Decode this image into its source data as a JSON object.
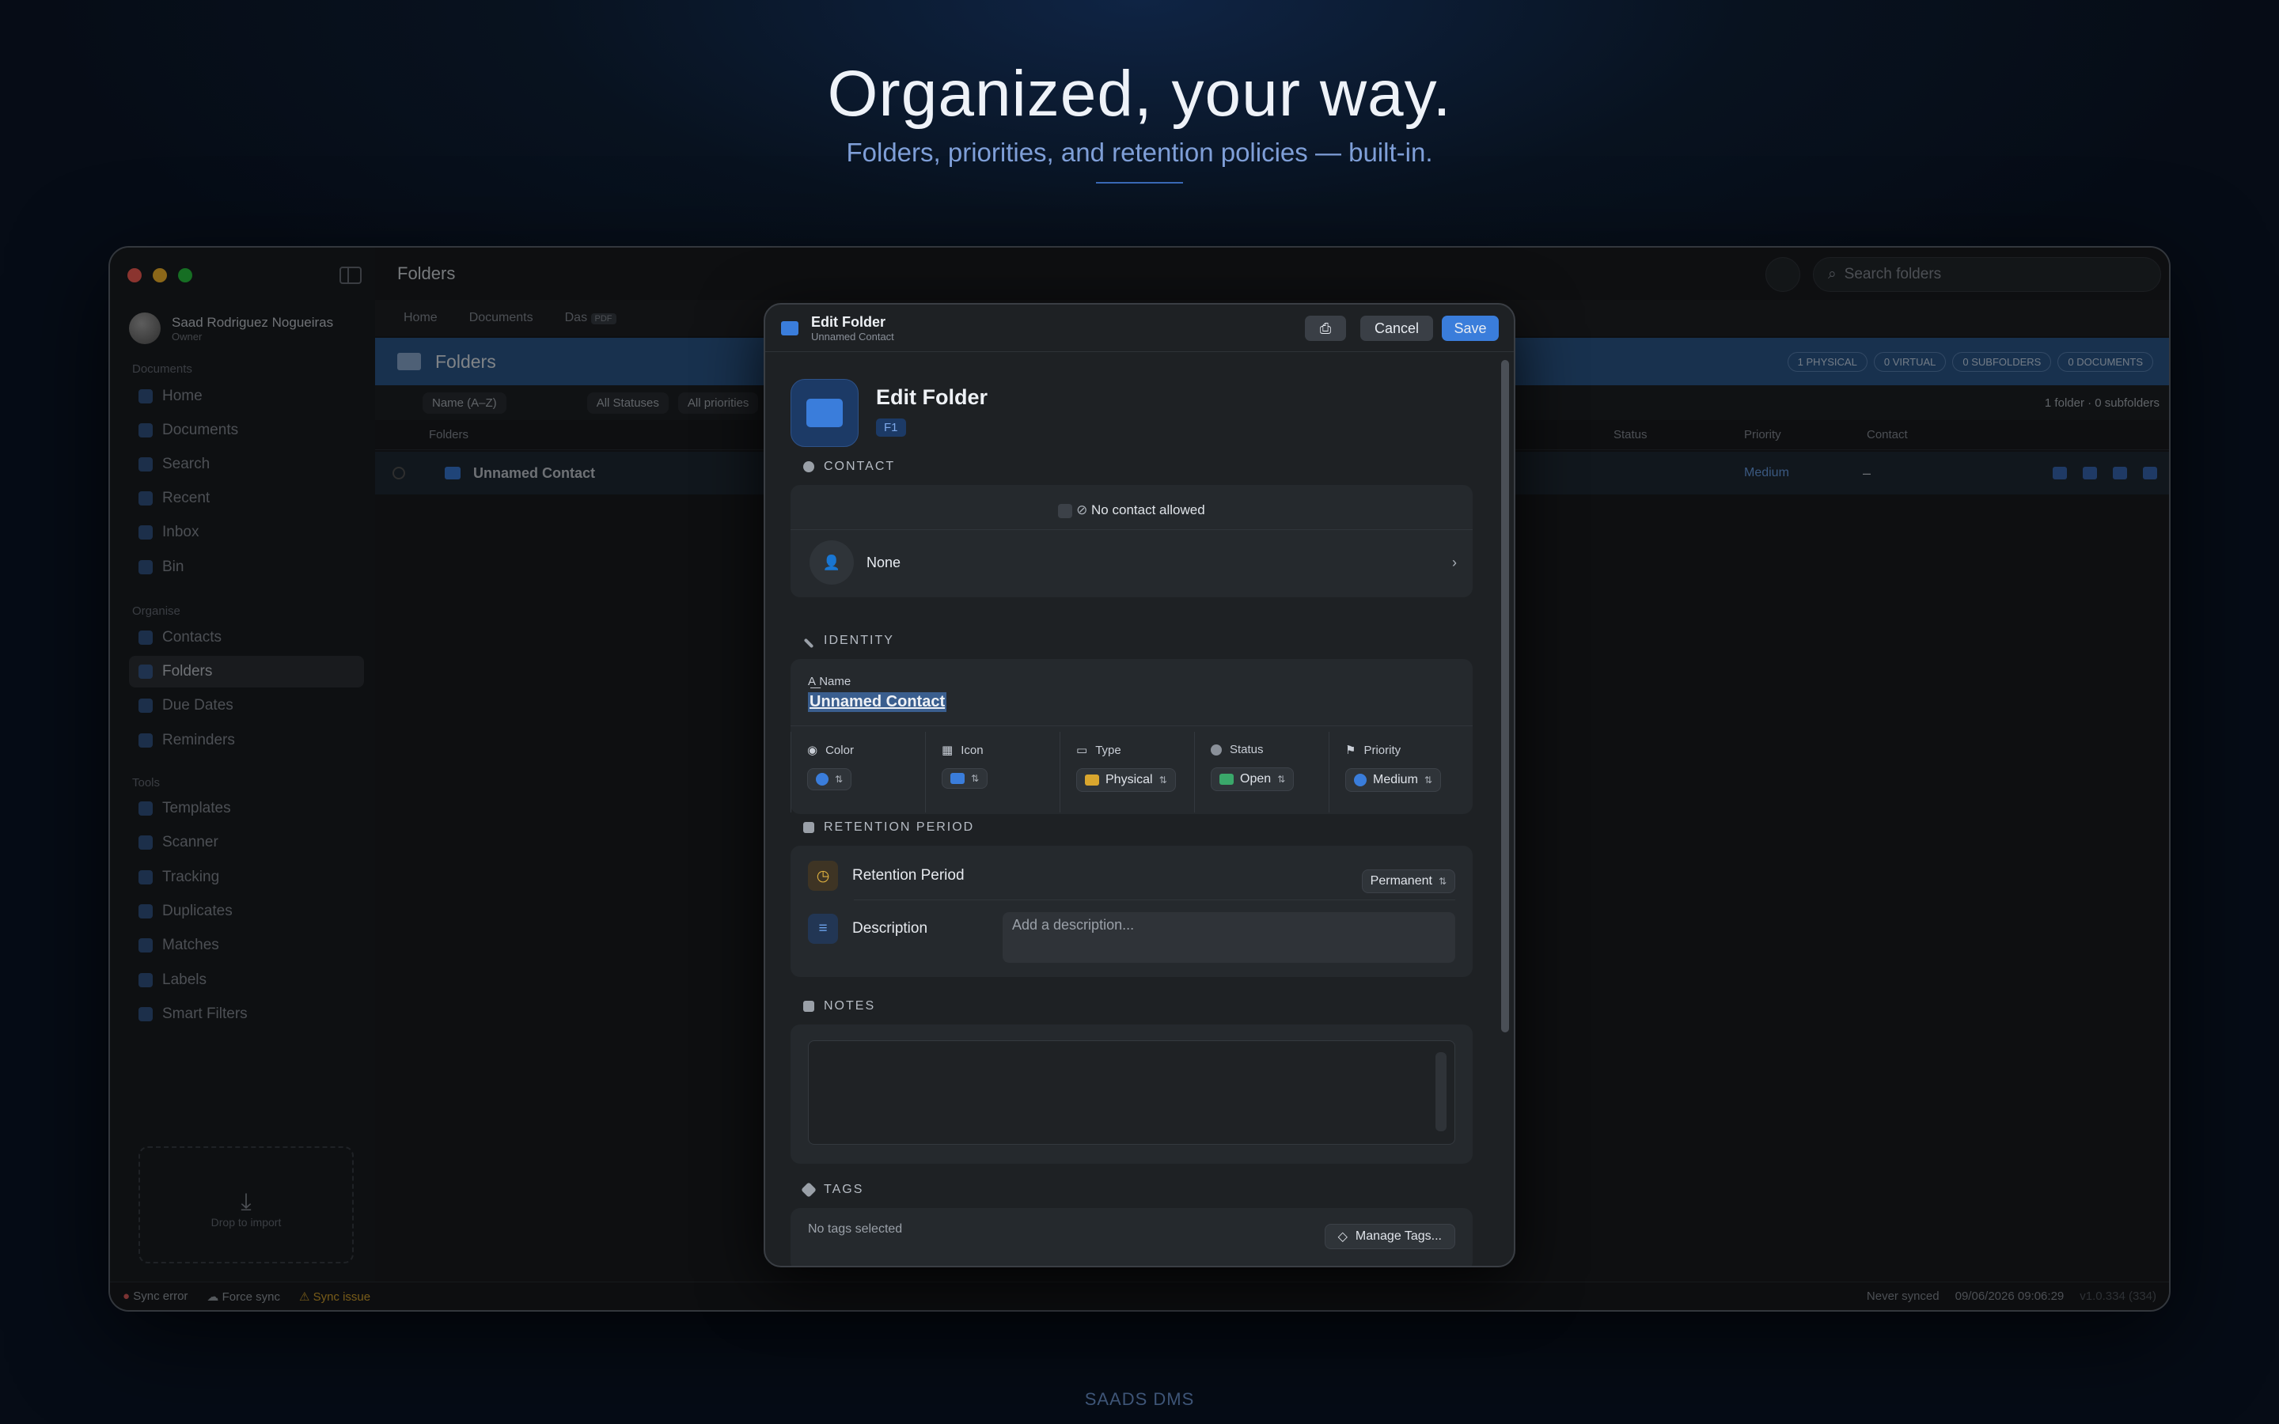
{
  "hero": {
    "title": "Organized, your way.",
    "subtitle": "Folders, priorities, and retention policies — built-in.",
    "footer": "SAADS DMS"
  },
  "colors": {
    "accent": "#3a7ddb",
    "danger": "#e05d5d",
    "warning": "#d9a62e",
    "traffic_red": "#fe5f57",
    "traffic_yellow": "#febc2e",
    "traffic_green": "#28c840"
  },
  "sidebar": {
    "user_name": "Saad Rodriguez Nogueiras",
    "user_role": "Owner",
    "sections": {
      "documents": "Documents",
      "organise": "Organise",
      "tools": "Tools"
    },
    "documents_items": [
      {
        "label": "Home",
        "icon": "home-icon"
      },
      {
        "label": "Documents",
        "icon": "document-icon"
      },
      {
        "label": "Search",
        "icon": "search-icon"
      },
      {
        "label": "Recent",
        "icon": "clock-icon"
      },
      {
        "label": "Inbox",
        "icon": "inbox-icon"
      },
      {
        "label": "Bin",
        "icon": "trash-icon"
      }
    ],
    "organise_items": [
      {
        "label": "Contacts",
        "icon": "contacts-icon"
      },
      {
        "label": "Folders",
        "icon": "folder-icon"
      },
      {
        "label": "Due Dates",
        "icon": "calendar-icon"
      },
      {
        "label": "Reminders",
        "icon": "bell-icon"
      }
    ],
    "tools_items": [
      {
        "label": "Templates",
        "icon": "template-icon"
      },
      {
        "label": "Scanner",
        "icon": "scanner-icon"
      },
      {
        "label": "Tracking",
        "icon": "tracking-icon"
      },
      {
        "label": "Duplicates",
        "icon": "duplicates-icon"
      },
      {
        "label": "Matches",
        "icon": "matches-icon"
      },
      {
        "label": "Labels",
        "icon": "label-icon"
      },
      {
        "label": "Smart Filters",
        "icon": "filter-icon"
      }
    ],
    "drop_label": "Drop to import"
  },
  "statusbar": {
    "sync_error": "Sync error",
    "force_sync": "Force sync",
    "sync_issue": "Sync issue",
    "never_synced": "Never synced",
    "datetime": "09/06/2026  09:06:29",
    "version": "v1.0.334 (334)"
  },
  "main": {
    "title": "Folders",
    "search_placeholder": "Search folders",
    "tabs": [
      "Home",
      "Documents",
      "Das"
    ],
    "tab_badge": "PDF",
    "header_title": "Folders",
    "pills": [
      {
        "count": "1",
        "label": "PHYSICAL"
      },
      {
        "count": "0",
        "label": "VIRTUAL"
      },
      {
        "count": "0",
        "label": "SUBFOLDERS"
      },
      {
        "count": "0",
        "label": "DOCUMENTS"
      }
    ],
    "sort_label": "Name (A–Z)",
    "filter_status": "All Statuses",
    "filter_priority": "All priorities",
    "summary": "1 folder  ·  0 subfolders",
    "columns": {
      "name": "Folders",
      "status": "Status",
      "priority": "Priority",
      "contact": "Contact"
    },
    "row": {
      "name": "Unnamed Contact",
      "priority": "Medium",
      "contact": "–"
    }
  },
  "modal": {
    "title": "Edit Folder",
    "subtitle": "Unnamed Contact",
    "cancel": "Cancel",
    "save": "Save",
    "big_title": "Edit Folder",
    "badge": "F1",
    "contact_section": "CONTACT",
    "no_contact": "No contact allowed",
    "contact_value": "None",
    "identity_section": "IDENTITY",
    "name_label": "Name",
    "name_value": "Unnamed Contact",
    "attr_labels": {
      "color": "Color",
      "icon": "Icon",
      "type": "Type",
      "status": "Status",
      "priority": "Priority"
    },
    "type_value": "Physical",
    "status_value": "Open",
    "priority_value": "Medium",
    "retention_section": "RETENTION PERIOD",
    "retention_label": "Retention Period",
    "retention_value": "Permanent",
    "description_label": "Description",
    "description_placeholder": "Add a description...",
    "notes_section": "NOTES",
    "tags_section": "TAGS",
    "no_tags": "No tags selected",
    "manage_tags": "Manage Tags..."
  }
}
